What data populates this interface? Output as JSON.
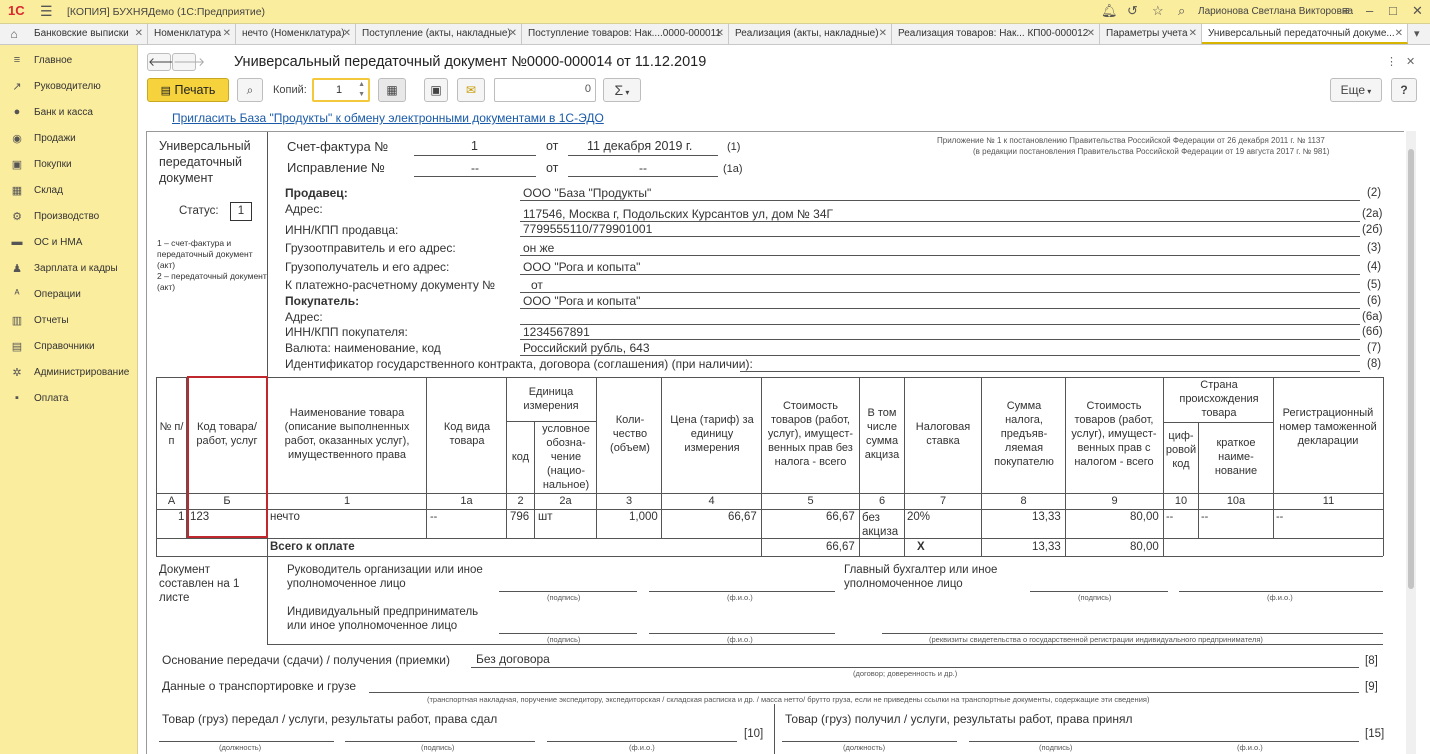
{
  "app": {
    "logo": "1С",
    "window_title": "[КОПИЯ] БУХНЯДемо  (1С:Предприятие)",
    "user": "Ларионова Светлана Викторовна"
  },
  "tabs": [
    {
      "label": "Банковские выписки"
    },
    {
      "label": "Номенклатура"
    },
    {
      "label": "нечто (Номенклатура)"
    },
    {
      "label": "Поступление (акты, накладные)"
    },
    {
      "label": "Поступление товаров: Нак....0000-000011"
    },
    {
      "label": "Реализация (акты, накладные)"
    },
    {
      "label": "Реализация товаров: Нак... КП00-000012"
    },
    {
      "label": "Параметры учета"
    },
    {
      "label": "Универсальный передаточный докуме..."
    }
  ],
  "sidebar": {
    "items": [
      {
        "label": "Главное",
        "icon": "menu-icon"
      },
      {
        "label": "Руководителю",
        "icon": "chart-icon"
      },
      {
        "label": "Банк и касса",
        "icon": "coins-icon"
      },
      {
        "label": "Продажи",
        "icon": "cart-icon"
      },
      {
        "label": "Покупки",
        "icon": "basket-icon"
      },
      {
        "label": "Склад",
        "icon": "grid-icon"
      },
      {
        "label": "Производство",
        "icon": "factory-icon"
      },
      {
        "label": "ОС и НМА",
        "icon": "truck-icon"
      },
      {
        "label": "Зарплата и кадры",
        "icon": "person-icon"
      },
      {
        "label": "Операции",
        "icon": "operations-icon"
      },
      {
        "label": "Отчеты",
        "icon": "report-icon"
      },
      {
        "label": "Справочники",
        "icon": "book-icon"
      },
      {
        "label": "Администрирование",
        "icon": "gear-icon"
      },
      {
        "label": "Оплата",
        "icon": "payment-icon"
      }
    ]
  },
  "form": {
    "title": "Универсальный передаточный документ №0000-000014 от 11.12.2019",
    "print_label": "Печать",
    "copies_label": "Копий:",
    "copies_value": "1",
    "sum_value": "0",
    "sum_symbol": "Σ",
    "more_label": "Еще",
    "help_label": "?",
    "invite_link": "Пригласить База \"Продукты\" к обмену электронными документами в 1С-ЭДО"
  },
  "doc": {
    "left_title": "Универсальный передаточный документ",
    "status_label": "Статус:",
    "status_value": "1",
    "status_note": "1 – счет-фактура и передаточный документ (акт)\n2 – передаточный документ (акт)",
    "appendix_line1": "Приложение № 1 к постановлению Правительства Российской Федерации от 26 декабря 2011 г. № 1137",
    "appendix_line2": "(в редакции постановления Правительства Российской Федерации от 19 августа 2017 г. № 981)",
    "invoice_label": "Счет-фактура №",
    "invoice_no": "1",
    "from_label": "от",
    "invoice_date": "11 декабря 2019 г.",
    "invoice_code": "(1)",
    "correction_label": "Исправление №",
    "correction_no": "--",
    "correction_date": "--",
    "correction_code": "(1а)",
    "fields": [
      {
        "label": "Продавец:",
        "value": "ООО \"База \"Продукты\"",
        "code": "(2)",
        "bold": true
      },
      {
        "label": "Адрес:",
        "value": "117546, Москва г, Подольских Курсантов ул, дом № 34Г",
        "code": "(2а)"
      },
      {
        "label": "ИНН/КПП продавца:",
        "value": "7799555110/779901001",
        "code": "(2б)"
      },
      {
        "label": "Грузоотправитель и его адрес:",
        "value": "он же",
        "code": "(3)"
      },
      {
        "label": "Грузополучатель и его адрес:",
        "value": "ООО \"Рога и копыта\"",
        "code": "(4)"
      },
      {
        "label": "К платежно-расчетному документу №",
        "value": "от",
        "code": "(5)"
      },
      {
        "label": "Покупатель:",
        "value": "ООО \"Рога и копыта\"",
        "code": "(6)",
        "bold": true
      },
      {
        "label": "Адрес:",
        "value": "",
        "code": "(6а)"
      },
      {
        "label": "ИНН/КПП покупателя:",
        "value": "1234567891",
        "code": "(6б)"
      },
      {
        "label": "Валюта: наименование, код",
        "value": "Российский рубль, 643",
        "code": "(7)"
      },
      {
        "label": "Идентификатор государственного контракта, договора (соглашения) (при наличии):",
        "value": "",
        "code": "(8)"
      }
    ],
    "table_headers": {
      "n": "№ п/п",
      "code": "Код товара/ работ, услуг",
      "name": "Наименование товара (описание выполненных работ, оказанных услуг), имущественного права",
      "kind": "Код вида товара",
      "unit": "Единица измерения",
      "unit_code": "код",
      "unit_name": "условное обозна-чение (нацио-нальное)",
      "qty": "Коли-чество (объем)",
      "price": "Цена (тариф) за единицу измерения",
      "cost_no_tax": "Стоимость товаров (работ, услуг), имущест-венных прав без налога - всего",
      "excise": "В том числе сумма акциза",
      "rate": "Налоговая ставка",
      "tax": "Сумма налога, предъяв-ляемая покупателю",
      "cost_tax": "Стоимость товаров (работ, услуг), имущест-венных прав с налогом - всего",
      "country": "Страна происхождения товара",
      "country_code": "циф-ровой код",
      "country_name": "краткое наиме-нование",
      "decl": "Регистрационный номер таможенной декларации"
    },
    "col_numbers": [
      "А",
      "Б",
      "1",
      "1а",
      "2",
      "2а",
      "3",
      "4",
      "5",
      "6",
      "7",
      "8",
      "9",
      "10",
      "10а",
      "11"
    ],
    "row": {
      "n": "1",
      "code": "123",
      "name": "нечто",
      "kind": "--",
      "unit_code": "796",
      "unit_name": "шт",
      "qty": "1,000",
      "price": "66,67",
      "cost_no_tax": "66,67",
      "excise": "без акциза",
      "rate": "20%",
      "tax": "13,33",
      "cost_tax": "80,00",
      "country_code": "--",
      "country_name": "--",
      "decl": "--"
    },
    "total": {
      "label": "Всего к оплате",
      "cost_no_tax": "66,67",
      "excise": "X",
      "tax": "13,33",
      "cost_tax": "80,00"
    },
    "composed": "Документ составлен на 1 листе",
    "head_org": "Руководитель организации или иное уполномоченное лицо",
    "chief_acc": "Главный бухгалтер или иное уполномоченное лицо",
    "ip": "Индивидуальный предприниматель или иное уполномоченное лицо",
    "sig": "(подпись)",
    "fio": "(ф.и.о.)",
    "ip_note": "(реквизиты свидетельства о государственной  регистрации индивидуального предпринимателя)",
    "basis_label": "Основание передачи (сдачи) / получения (приемки)",
    "basis_value": "Без договора",
    "basis_note": "(договор; доверенность и др.)",
    "basis_code": "[8]",
    "transport_label": "Данные о транспортировке и грузе",
    "transport_note": "(транспортная накладная, поручение экспедитору, экспедиторская / складская расписка и др. / масса нетто/ брутто груза, если не приведены ссылки на транспортные документы, содержащие эти сведения)",
    "transport_code": "[9]",
    "gave_label": "Товар (груз) передал / услуги, результаты работ, права сдал",
    "gave_code": "[10]",
    "got_label": "Товар (груз) получил / услуги, результаты работ, права принял",
    "got_code": "[15]",
    "position": "(должность)"
  }
}
